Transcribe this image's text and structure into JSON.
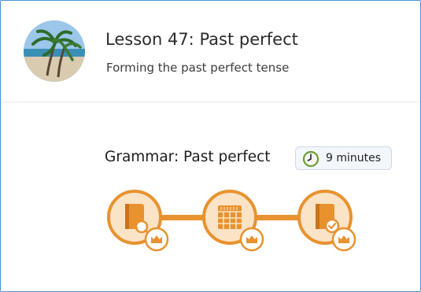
{
  "lesson": {
    "title": "Lesson 47: Past perfect",
    "subtitle": "Forming the past perfect tense"
  },
  "section": {
    "title": "Grammar: Past perfect",
    "duration": "9 minutes"
  },
  "steps": [
    {
      "icon": "book-search-icon"
    },
    {
      "icon": "document-table-icon"
    },
    {
      "icon": "book-check-icon"
    }
  ],
  "colors": {
    "accent": "#e8922f",
    "accent_light": "#f6c58b",
    "badge_bg": "#f3f7fc",
    "clock_green": "#6f9e2e"
  }
}
